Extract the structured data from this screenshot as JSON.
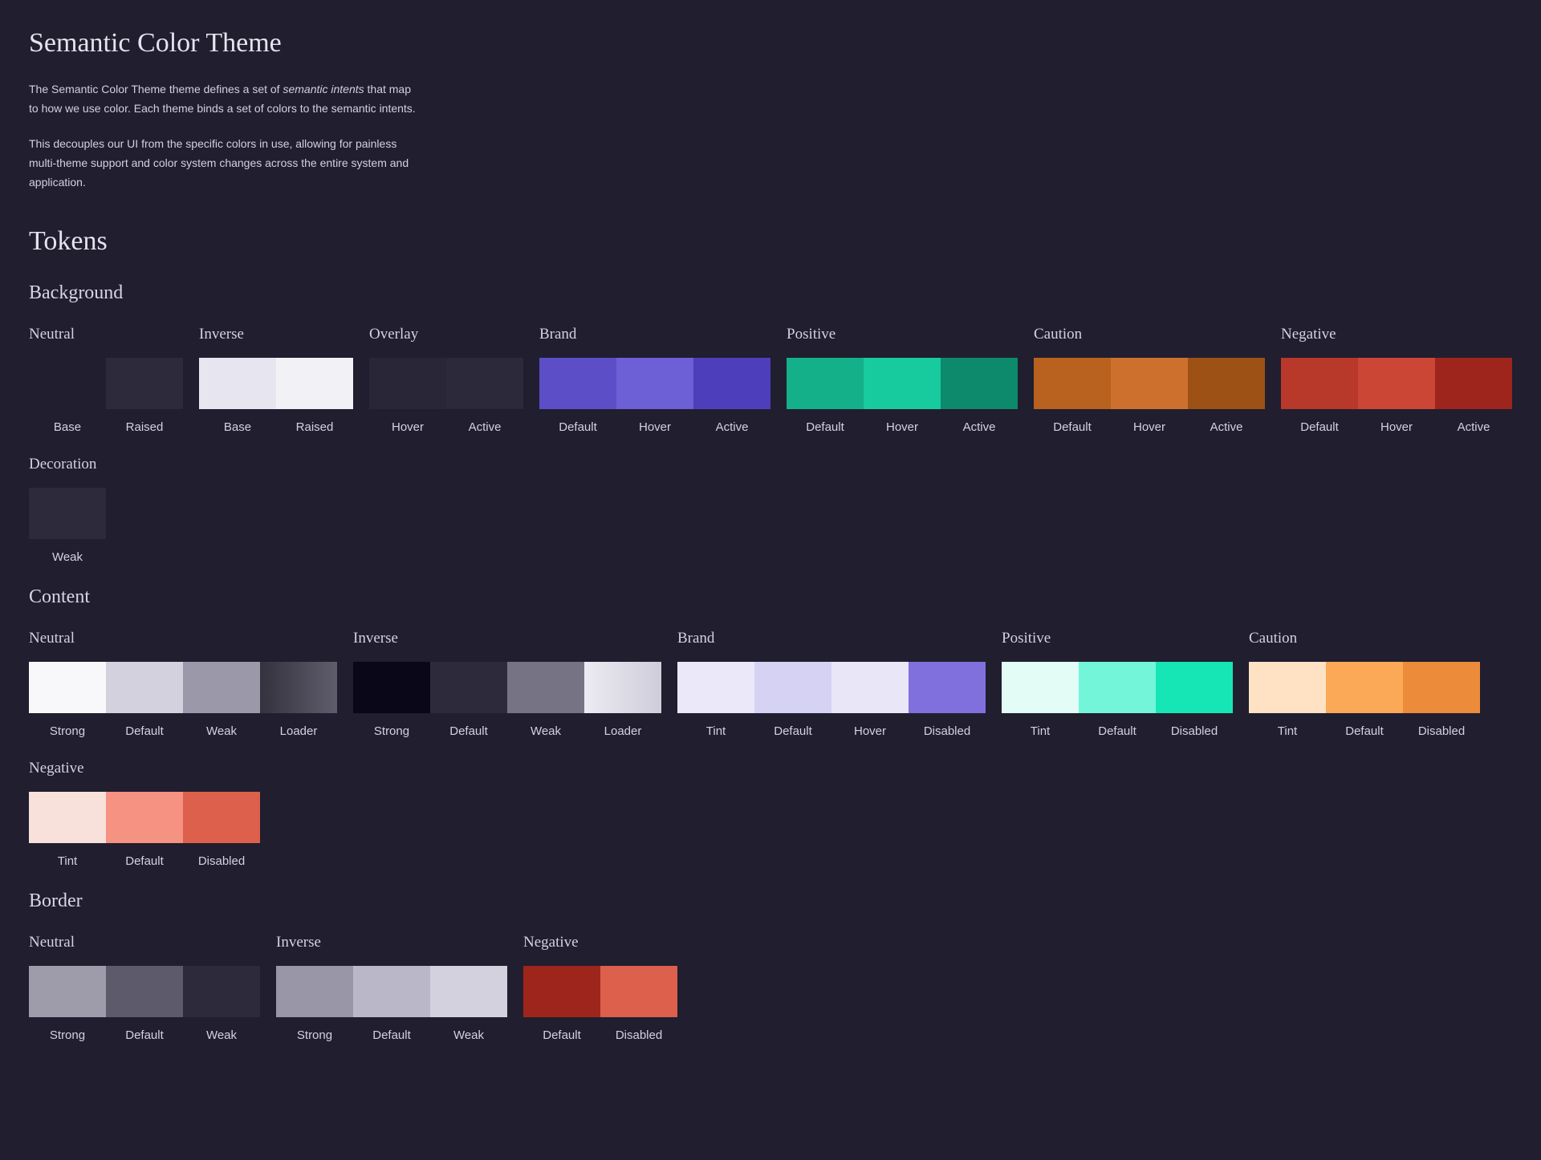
{
  "title": "Semantic Color Theme",
  "intro": {
    "p1_before": "The Semantic Color Theme theme defines a set of ",
    "p1_em": "semantic intents",
    "p1_after": " that map to how we use color. Each theme binds a set of colors to the semantic intents.",
    "p2": "This decouples our UI from the specific colors in use, allowing for painless multi-theme support and color system changes across the entire system and application."
  },
  "tokens_heading": "Tokens",
  "sections": [
    {
      "title": "Background",
      "groups": [
        {
          "title": "Neutral",
          "swatches": [
            {
              "label": "Base",
              "color": "#201e2f"
            },
            {
              "label": "Raised",
              "color": "#2c2a3b"
            }
          ]
        },
        {
          "title": "Inverse",
          "swatches": [
            {
              "label": "Base",
              "color": "#e7e5ef"
            },
            {
              "label": "Raised",
              "color": "#f2f1f6"
            }
          ]
        },
        {
          "title": "Overlay",
          "swatches": [
            {
              "label": "Hover",
              "color": "#292737"
            },
            {
              "label": "Active",
              "color": "#2c2a3a"
            }
          ]
        },
        {
          "title": "Brand",
          "swatches": [
            {
              "label": "Default",
              "color": "#5b4ec7"
            },
            {
              "label": "Hover",
              "color": "#6d5fd6"
            },
            {
              "label": "Active",
              "color": "#4d3fbb"
            }
          ]
        },
        {
          "title": "Positive",
          "swatches": [
            {
              "label": "Default",
              "color": "#13b08a"
            },
            {
              "label": "Hover",
              "color": "#17cb9f"
            },
            {
              "label": "Active",
              "color": "#0d8a6c"
            }
          ]
        },
        {
          "title": "Caution",
          "swatches": [
            {
              "label": "Default",
              "color": "#b9611f"
            },
            {
              "label": "Hover",
              "color": "#ce702d"
            },
            {
              "label": "Active",
              "color": "#9d5114"
            }
          ]
        },
        {
          "title": "Negative",
          "swatches": [
            {
              "label": "Default",
              "color": "#b8382a"
            },
            {
              "label": "Hover",
              "color": "#cb4634"
            },
            {
              "label": "Active",
              "color": "#9e251c"
            }
          ]
        },
        {
          "title": "Decoration",
          "swatches": [
            {
              "label": "Weak",
              "color": "#2c2a3b"
            }
          ]
        }
      ]
    },
    {
      "title": "Content",
      "groups": [
        {
          "title": "Neutral",
          "swatches": [
            {
              "label": "Strong",
              "color": "#f8f8fa"
            },
            {
              "label": "Default",
              "color": "#d3d1de"
            },
            {
              "label": "Weak",
              "color": "#9b98a9"
            },
            {
              "label": "Loader",
              "color": "linear-gradient(90deg, #35323f 0%, #5f5c6c 100%)"
            }
          ]
        },
        {
          "title": "Inverse",
          "swatches": [
            {
              "label": "Strong",
              "color": "#0a0718"
            },
            {
              "label": "Default",
              "color": "#2c2a3b"
            },
            {
              "label": "Weak",
              "color": "#767385"
            },
            {
              "label": "Loader",
              "color": "linear-gradient(90deg, #ecebf2 0%, #cfcdda 100%)"
            }
          ]
        },
        {
          "title": "Brand",
          "swatches": [
            {
              "label": "Tint",
              "color": "#eae8f9"
            },
            {
              "label": "Default",
              "color": "#d6d2f4"
            },
            {
              "label": "Hover",
              "color": "#e9e6f8"
            },
            {
              "label": "Disabled",
              "color": "#7f70de"
            }
          ]
        },
        {
          "title": "Positive",
          "swatches": [
            {
              "label": "Tint",
              "color": "#e3fcf5"
            },
            {
              "label": "Default",
              "color": "#72f5d8"
            },
            {
              "label": "Disabled",
              "color": "#16e6b5"
            }
          ]
        },
        {
          "title": "Caution",
          "swatches": [
            {
              "label": "Tint",
              "color": "#ffe2c4"
            },
            {
              "label": "Default",
              "color": "#fba957"
            },
            {
              "label": "Disabled",
              "color": "#ec8b3a"
            }
          ]
        },
        {
          "title": "Negative",
          "swatches": [
            {
              "label": "Tint",
              "color": "#f8e0db"
            },
            {
              "label": "Default",
              "color": "#f59282"
            },
            {
              "label": "Disabled",
              "color": "#dc604c"
            }
          ]
        }
      ]
    },
    {
      "title": "Border",
      "groups": [
        {
          "title": "Neutral",
          "swatches": [
            {
              "label": "Strong",
              "color": "#9e9bab"
            },
            {
              "label": "Default",
              "color": "#5d5a6b"
            },
            {
              "label": "Weak",
              "color": "#2c2a3b"
            }
          ]
        },
        {
          "title": "Inverse",
          "swatches": [
            {
              "label": "Strong",
              "color": "#9996a7"
            },
            {
              "label": "Default",
              "color": "#bab7c9"
            },
            {
              "label": "Weak",
              "color": "#d3d1de"
            }
          ]
        },
        {
          "title": "Negative",
          "swatches": [
            {
              "label": "Default",
              "color": "#9e251c"
            },
            {
              "label": "Disabled",
              "color": "#dc604c"
            }
          ]
        }
      ]
    }
  ]
}
